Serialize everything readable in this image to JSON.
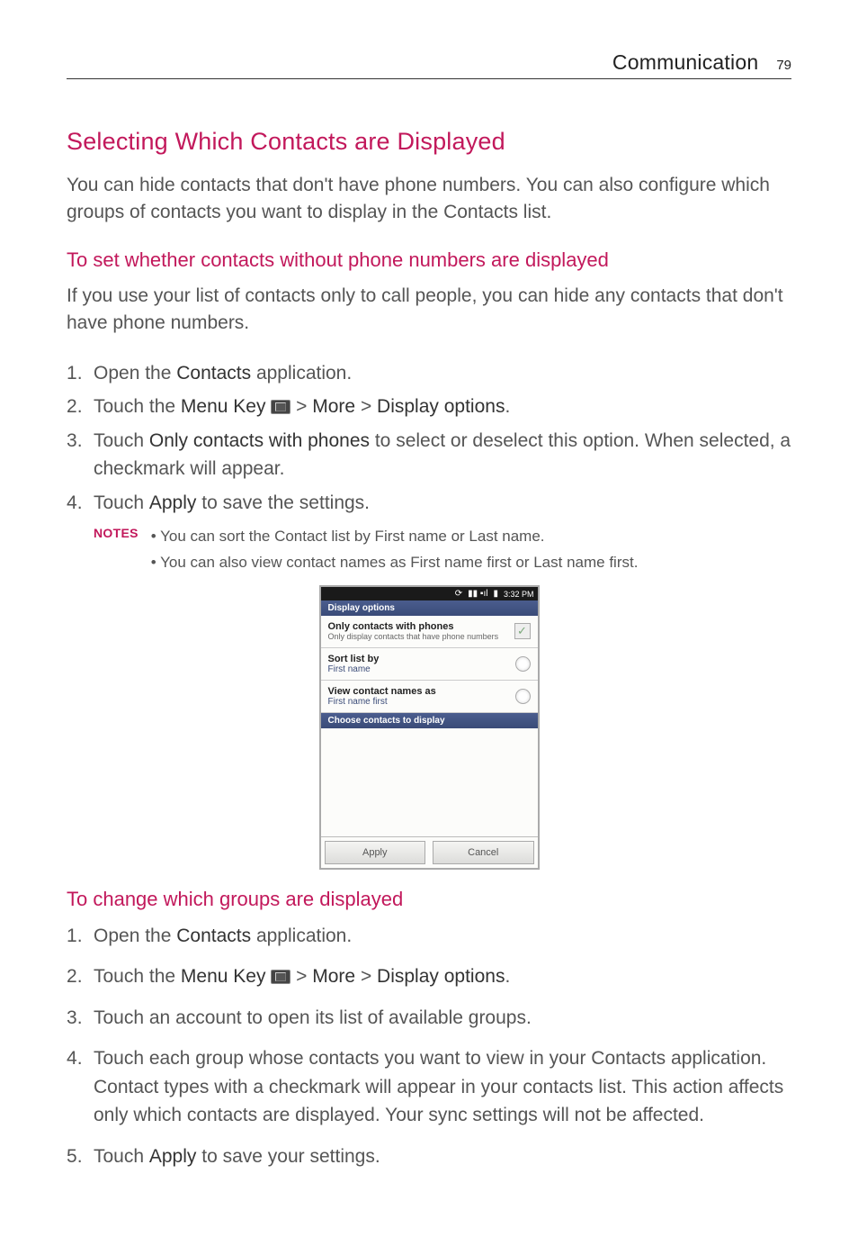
{
  "header": {
    "section": "Communication",
    "page": "79"
  },
  "h1": "Selecting Which Contacts are Displayed",
  "intro": "You can hide contacts that don't have phone numbers. You can also configure which groups of contacts you want to display in the Contacts list.",
  "sec1": {
    "heading": "To set whether contacts without phone numbers are displayed",
    "para": "If you use your list of contacts only to call people, you can hide any contacts that don't have phone numbers.",
    "steps": {
      "s1a": "Open the ",
      "s1b": "Contacts",
      "s1c": " application.",
      "s2a": "Touch the ",
      "s2b": "Menu Key",
      "s2c": " > ",
      "s2d": "More",
      "s2e": " > ",
      "s2f": "Display options",
      "s2g": ".",
      "s3a": "Touch ",
      "s3b": "Only contacts with phones",
      "s3c": " to select or deselect this option. When selected, a checkmark will appear.",
      "s4a": "Touch ",
      "s4b": "Apply",
      "s4c": " to save the settings."
    },
    "notes_label": "NOTES",
    "notes": {
      "n1": "You can sort the Contact list by First name or Last name.",
      "n2": "You can also view contact names as First name first or Last name first."
    }
  },
  "phone": {
    "status": {
      "time": "3:32 PM"
    },
    "hdr1": "Display options",
    "opt1": {
      "title": "Only contacts with phones",
      "sub": "Only display contacts that have phone numbers",
      "check": "✓"
    },
    "opt2": {
      "title": "Sort list by",
      "sub": "First name"
    },
    "opt3": {
      "title": "View contact names as",
      "sub": "First name first"
    },
    "hdr2": "Choose contacts to display",
    "apply": "Apply",
    "cancel": "Cancel"
  },
  "sec2": {
    "heading": "To change which groups are displayed",
    "steps": {
      "s1a": "Open the ",
      "s1b": "Contacts",
      "s1c": " application.",
      "s2a": "Touch the ",
      "s2b": "Menu Key",
      "s2c": " > ",
      "s2d": "More",
      "s2e": " > ",
      "s2f": "Display options",
      "s2g": ".",
      "s3": "Touch an account to open its list of available groups.",
      "s4": "Touch each group whose contacts you want to view in your Contacts application. Contact types with a checkmark will appear in your contacts list. This action affects only which contacts are displayed. Your sync settings will not be affected.",
      "s5a": "Touch ",
      "s5b": "Apply",
      "s5c": " to save your settings."
    }
  }
}
